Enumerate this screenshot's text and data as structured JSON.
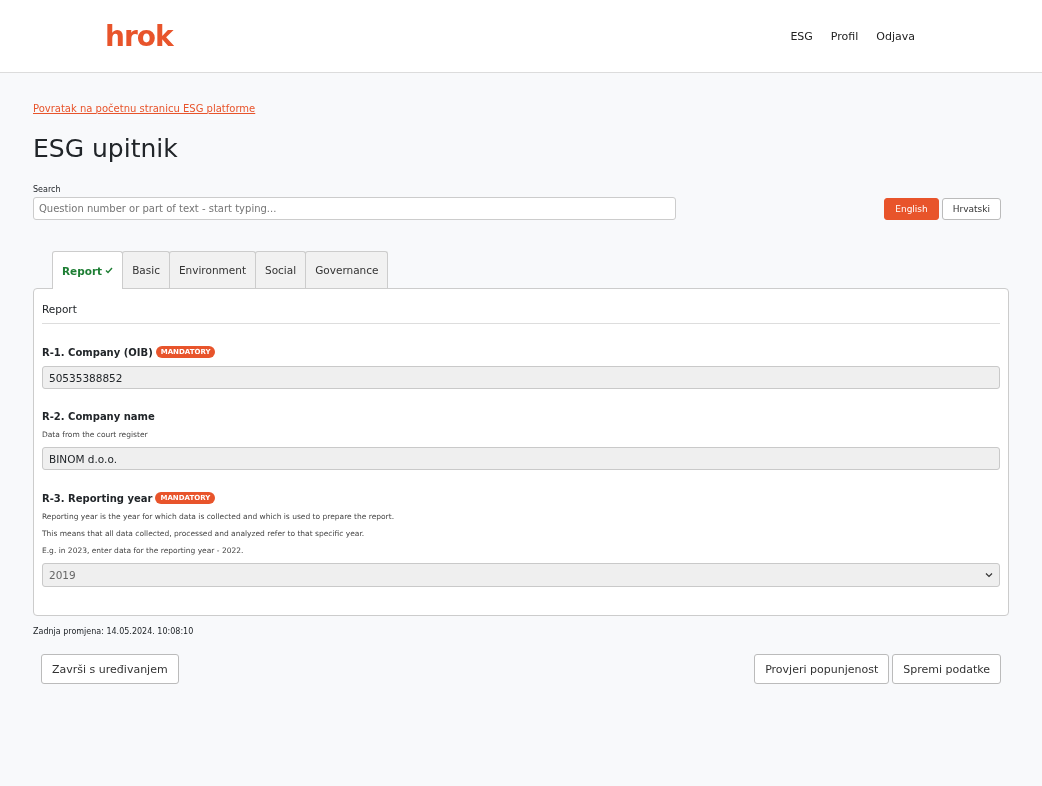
{
  "header": {
    "logo": "hrok",
    "nav": [
      "ESG",
      "Profil",
      "Odjava"
    ]
  },
  "back_link": "Povratak na početnu stranicu ESG platforme",
  "title": "ESG upitnik",
  "search": {
    "label": "Search",
    "placeholder": "Question number or part of text - start typing..."
  },
  "languages": [
    {
      "label": "English",
      "selected": true
    },
    {
      "label": "Hrvatski",
      "selected": false
    }
  ],
  "tabs": [
    {
      "label": "Report",
      "selected": true,
      "complete": true
    },
    {
      "label": "Basic",
      "selected": false,
      "complete": false
    },
    {
      "label": "Environment",
      "selected": false,
      "complete": false
    },
    {
      "label": "Social",
      "selected": false,
      "complete": false
    },
    {
      "label": "Governance",
      "selected": false,
      "complete": false
    }
  ],
  "section_title": "Report",
  "questions": [
    {
      "kind": "input",
      "label": "R-1. Company (OIB)",
      "mandatory": true,
      "badge": "MANDATORY",
      "value": "50535388852"
    },
    {
      "kind": "input",
      "label": "R-2. Company name",
      "mandatory": false,
      "help": [
        "Data from the court register"
      ],
      "value": "BINOM d.o.o."
    },
    {
      "kind": "select",
      "label": "R-3. Reporting year",
      "mandatory": true,
      "badge": "MANDATORY",
      "help": [
        "Reporting year is the year for which data is collected and which is used to prepare the report.",
        "This means that all data collected, processed and analyzed refer to that specific year.",
        "E.g. in 2023, enter data for the reporting year - 2022."
      ],
      "value": "2019"
    }
  ],
  "last_change": "Zadnja promjena: 14.05.2024. 10:08:10",
  "buttons": {
    "left": "Završi s uređivanjem",
    "right": [
      "Provjeri popunjenost",
      "Spremi podatke"
    ]
  }
}
